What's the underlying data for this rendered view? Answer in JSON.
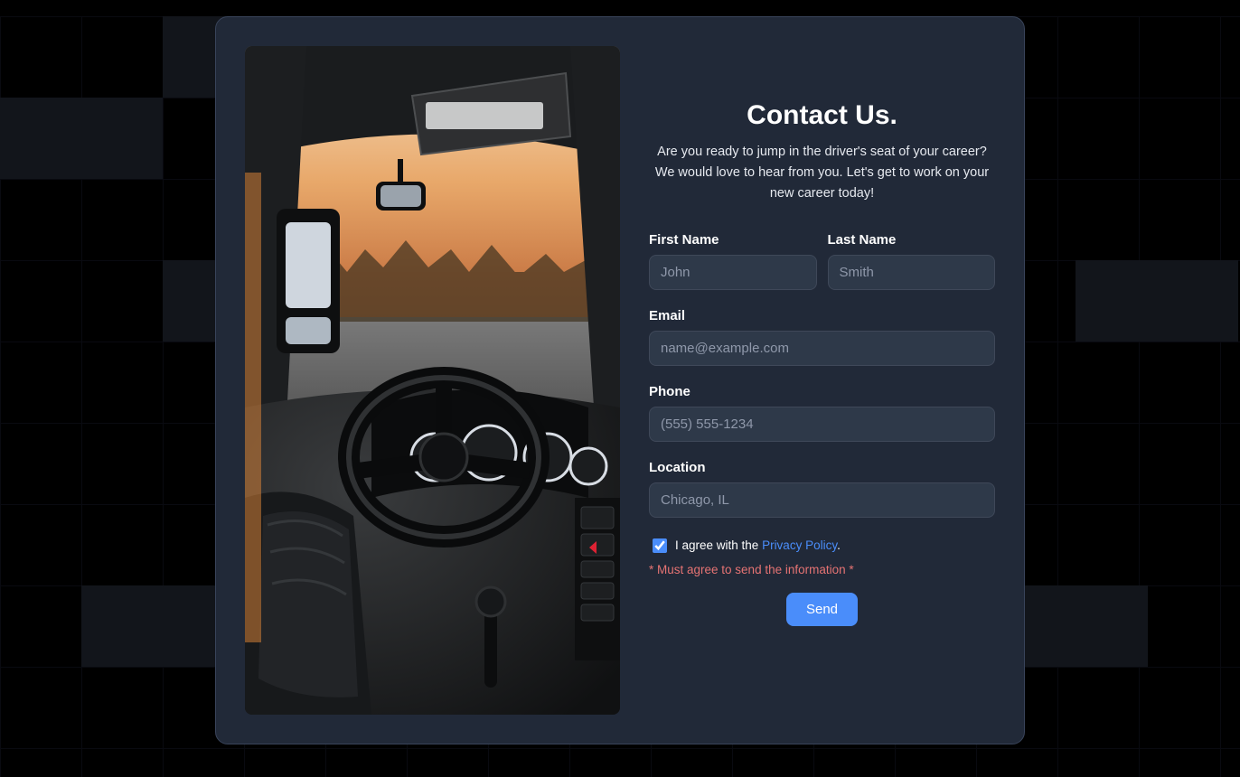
{
  "title": "Contact Us.",
  "lead": "Are you ready to jump in the driver's seat of your career? We would love to hear from you. Let's get to work on your new career today!",
  "form": {
    "first_name": {
      "label": "First Name",
      "placeholder": "John"
    },
    "last_name": {
      "label": "Last Name",
      "placeholder": "Smith"
    },
    "email": {
      "label": "Email",
      "placeholder": "name@example.com"
    },
    "phone": {
      "label": "Phone",
      "placeholder": "(555) 555-1234"
    },
    "location": {
      "label": "Location",
      "placeholder": "Chicago, IL"
    }
  },
  "consent": {
    "prefix": "I agree with the ",
    "link_text": "Privacy Policy",
    "suffix": ".",
    "checked": true
  },
  "warn": "* Must agree to send the information *",
  "send_label": "Send",
  "colors": {
    "accent": "#4a8dfa",
    "panel": "#212938",
    "warn": "#e57373"
  }
}
